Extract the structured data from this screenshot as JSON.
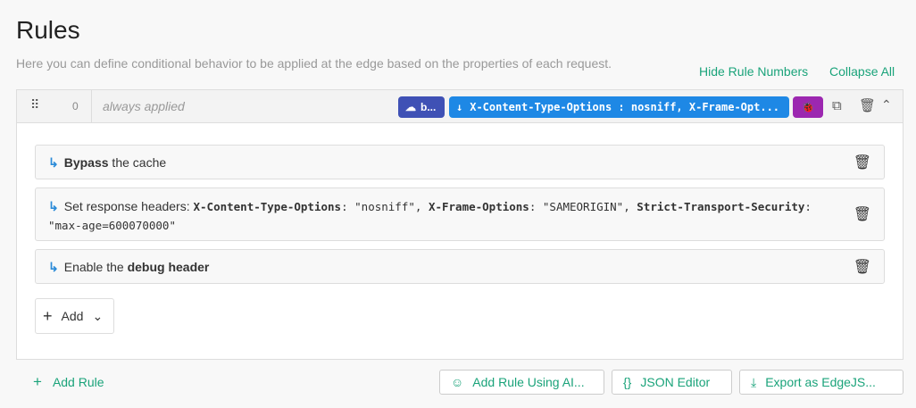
{
  "page": {
    "title": "Rules",
    "description": "Here you can define conditional behavior to be applied at the edge based on the properties of each request.",
    "hide_numbers": "Hide Rule Numbers",
    "collapse_all": "Collapse All"
  },
  "rule": {
    "number": "0",
    "condition": "always applied",
    "badges": [
      {
        "label": "b...",
        "icon": "cloud-off-icon",
        "color": "#3f51b5"
      },
      {
        "label": "X-Content-Type-Options : nosniff, X-Frame-Opt...",
        "icon": "arrow-down-icon",
        "color": "#1e88e5"
      },
      {
        "icon": "bug-icon",
        "color": "#9c27b0"
      }
    ],
    "actions": [
      {
        "bold": "Bypass",
        "rest": " the cache"
      },
      {
        "prefix": "Set response headers: ",
        "headers": [
          {
            "k": "X-Content-Type-Options",
            "v": "\"nosniff\""
          },
          {
            "k": "X-Frame-Options",
            "v": "\"SAMEORIGIN\""
          },
          {
            "k": "Strict-Transport-Security",
            "v": "\"max-age=600070000\""
          }
        ]
      },
      {
        "pre": "Enable the ",
        "bold": "debug header"
      }
    ],
    "add_label": "Add"
  },
  "footer": {
    "add_rule": "Add Rule",
    "add_ai": "Add Rule Using AI...",
    "json_editor": "JSON Editor",
    "export": "Export as EdgeJS..."
  },
  "colors": {
    "accent": "#1aa37a"
  }
}
